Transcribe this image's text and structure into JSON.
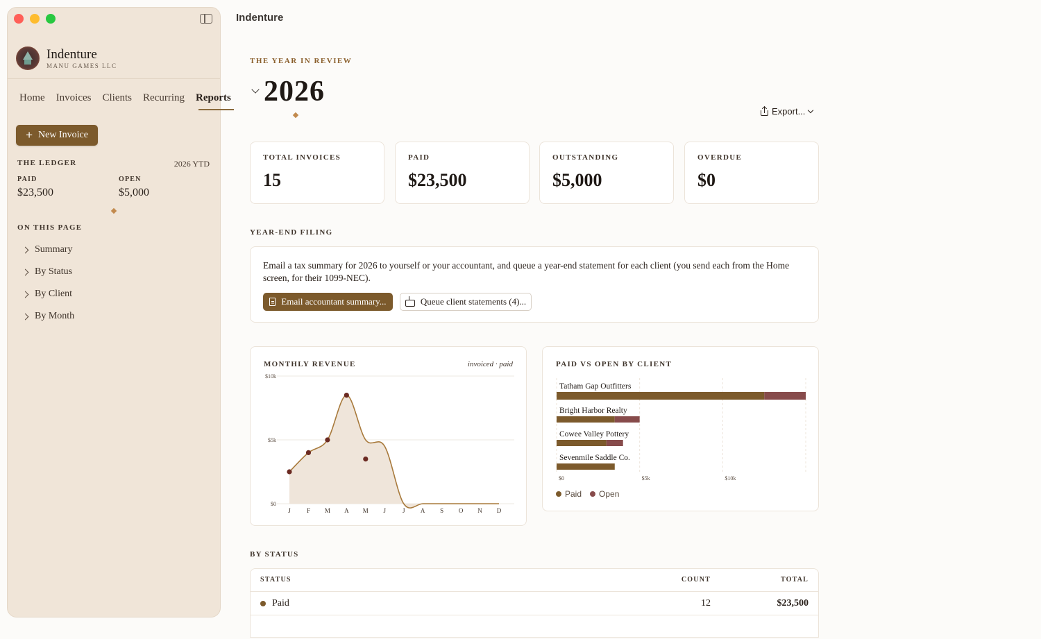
{
  "window": {
    "title": "Indenture"
  },
  "sidebar": {
    "brand": {
      "name": "Indenture",
      "subtitle": "MANU GAMES LLC"
    },
    "nav": [
      "Home",
      "Invoices",
      "Clients",
      "Recurring",
      "Reports"
    ],
    "active_nav": "Reports",
    "new_invoice_label": "New Invoice",
    "ledger": {
      "title": "THE LEDGER",
      "period": "2026 YTD",
      "paid_label": "PAID",
      "paid_value": "$23,500",
      "open_label": "OPEN",
      "open_value": "$5,000"
    },
    "on_this_page": {
      "title": "ON THIS PAGE",
      "items": [
        "Summary",
        "By Status",
        "By Client",
        "By Month"
      ]
    }
  },
  "header": {
    "eyebrow": "THE YEAR IN REVIEW",
    "year": "2026",
    "export_label": "Export..."
  },
  "stats": [
    {
      "label": "TOTAL INVOICES",
      "value": "15"
    },
    {
      "label": "PAID",
      "value": "$23,500"
    },
    {
      "label": "OUTSTANDING",
      "value": "$5,000"
    },
    {
      "label": "OVERDUE",
      "value": "$0"
    }
  ],
  "year_end": {
    "title": "YEAR-END FILING",
    "text": "Email a tax summary for 2026 to yourself or your accountant, and queue a year-end statement for each client (you send each from the Home screen, for their 1099-NEC).",
    "primary_button": "Email accountant summary...",
    "secondary_button": "Queue client statements (4)..."
  },
  "colors": {
    "paid": "#7c5a2c",
    "open": "#874b4b",
    "accent": "#8a5f2c",
    "line": "#a87a3c",
    "point": "#6b2a22"
  },
  "chart_data": [
    {
      "type": "area",
      "title": "MONTHLY REVENUE",
      "subtitle": "invoiced · paid",
      "categories": [
        "J",
        "F",
        "M",
        "A",
        "M",
        "J",
        "J",
        "A",
        "S",
        "O",
        "N",
        "D"
      ],
      "y_ticks": [
        "$10k",
        "$5k",
        "$0"
      ],
      "ylim": [
        0,
        10000
      ],
      "series": [
        {
          "name": "invoiced",
          "values": [
            2500,
            4000,
            5000,
            8500,
            5000,
            4500,
            0,
            0,
            0,
            0,
            0,
            0
          ]
        },
        {
          "name": "paid",
          "values": [
            2500,
            4000,
            5000,
            8500,
            3500,
            null,
            null,
            null,
            null,
            null,
            null,
            null
          ]
        }
      ],
      "grid": true
    },
    {
      "type": "bar",
      "title": "PAID VS OPEN BY CLIENT",
      "orientation": "horizontal",
      "stacked": true,
      "categories": [
        "Tatham Gap Outfitters",
        "Bright Harbor Realty",
        "Cowee Valley Pottery",
        "Sevenmile Saddle Co."
      ],
      "series": [
        {
          "name": "Paid",
          "values": [
            12500,
            3500,
            3000,
            3500
          ]
        },
        {
          "name": "Open",
          "values": [
            2500,
            1500,
            1000,
            0
          ]
        }
      ],
      "x_ticks": [
        "$0",
        "$5k",
        "$10k"
      ],
      "xlim": [
        0,
        15000
      ],
      "legend": "bottom-left"
    }
  ],
  "by_status": {
    "title": "BY STATUS",
    "columns": [
      "STATUS",
      "COUNT",
      "TOTAL"
    ],
    "rows": [
      {
        "status": "Paid",
        "count": "12",
        "total": "$23,500"
      }
    ]
  }
}
